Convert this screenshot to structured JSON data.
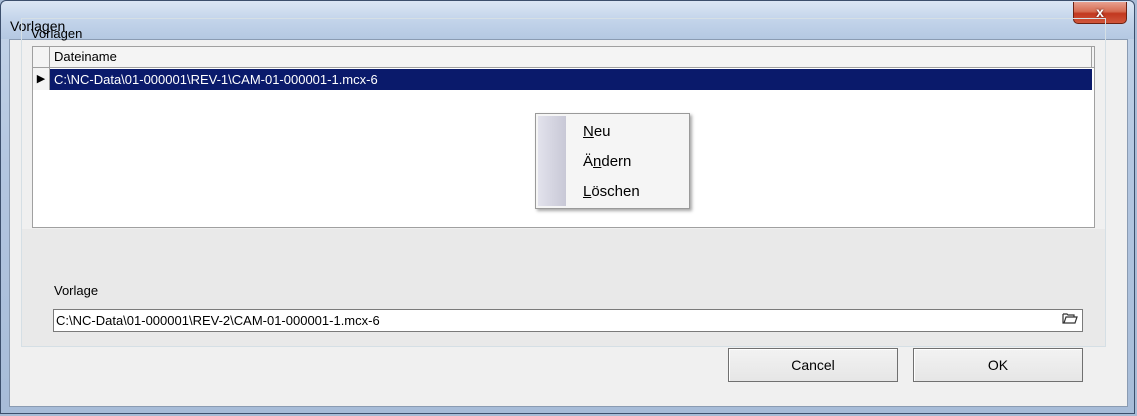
{
  "window": {
    "title": "Vorlagen",
    "close_glyph": "x"
  },
  "group": {
    "label": "Vorlagen"
  },
  "grid": {
    "columns": [
      "Dateiname"
    ],
    "rows": [
      {
        "indicator": "▶",
        "dateiname": "C:\\NC-Data\\01-000001\\REV-1\\CAM-01-000001-1.mcx-6",
        "selected": true
      }
    ]
  },
  "context_menu": {
    "items": [
      {
        "label": "Neu",
        "mnemonic_index": 0
      },
      {
        "label": "Ändern",
        "mnemonic_index": 1
      },
      {
        "label": "Löschen",
        "mnemonic_index": 0
      }
    ]
  },
  "vorlage": {
    "label": "Vorlage",
    "value": "C:\\NC-Data\\01-000001\\REV-2\\CAM-01-000001-1.mcx-6",
    "browse_icon": "folder-open-icon"
  },
  "buttons": {
    "cancel": "Cancel",
    "ok": "OK"
  },
  "colors": {
    "selection": "#0a1a6b",
    "close_button": "#c2381f"
  }
}
